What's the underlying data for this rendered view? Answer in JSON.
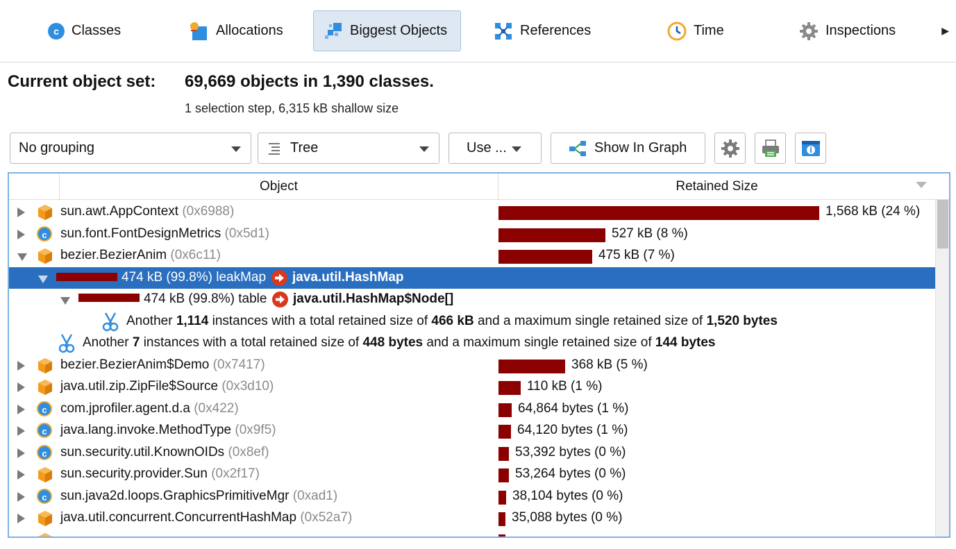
{
  "tabs": [
    {
      "label": "Classes",
      "icon": "class-icon"
    },
    {
      "label": "Allocations",
      "icon": "allocations-icon"
    },
    {
      "label": "Biggest Objects",
      "icon": "biggest-objects-icon",
      "active": true
    },
    {
      "label": "References",
      "icon": "references-icon"
    },
    {
      "label": "Time",
      "icon": "clock-icon"
    },
    {
      "label": "Inspections",
      "icon": "gear-icon"
    }
  ],
  "header": {
    "label": "Current object set:",
    "value": "69,669 objects in 1,390 classes.",
    "subtitle": "1 selection step, 6,315 kB shallow size"
  },
  "toolbar": {
    "grouping": "No grouping",
    "view": "Tree",
    "use": "Use ...",
    "show_in_graph": "Show In Graph"
  },
  "table": {
    "col_object": "Object",
    "col_retained": "Retained Size",
    "rows": [
      {
        "name": "sun.awt.AppContext",
        "addr": "(0x6988)",
        "size": "1,568 kB (24 %)",
        "pct": 24,
        "icon": "cube"
      },
      {
        "name": "sun.font.FontDesignMetrics",
        "addr": "(0x5d1)",
        "size": "527 kB (8 %)",
        "pct": 8,
        "icon": "class"
      },
      {
        "name": "bezier.BezierAnim",
        "addr": "(0x6c11)",
        "size": "475 kB (7 %)",
        "pct": 7,
        "icon": "cube"
      },
      {
        "name": "bezier.BezierAnim$Demo",
        "addr": "(0x7417)",
        "size": "368 kB (5 %)",
        "pct": 5,
        "icon": "cube"
      },
      {
        "name": "java.util.zip.ZipFile$Source",
        "addr": "(0x3d10)",
        "size": "110 kB (1 %)",
        "pct": 1.65,
        "icon": "cube"
      },
      {
        "name": "com.jprofiler.agent.d.a",
        "addr": "(0x422)",
        "size": "64,864 bytes (1 %)",
        "pct": 0.97,
        "icon": "class"
      },
      {
        "name": "java.lang.invoke.MethodType",
        "addr": "(0x9f5)",
        "size": "64,120 bytes (1 %)",
        "pct": 0.96,
        "icon": "class"
      },
      {
        "name": "sun.security.util.KnownOIDs",
        "addr": "(0x8ef)",
        "size": "53,392 bytes (0 %)",
        "pct": 0.8,
        "icon": "class"
      },
      {
        "name": "sun.security.provider.Sun",
        "addr": "(0x2f17)",
        "size": "53,264 bytes (0 %)",
        "pct": 0.8,
        "icon": "cube"
      },
      {
        "name": "sun.java2d.loops.GraphicsPrimitiveMgr",
        "addr": "(0xad1)",
        "size": "38,104 bytes (0 %)",
        "pct": 0.57,
        "icon": "class"
      },
      {
        "name": "java.util.concurrent.ConcurrentHashMap",
        "addr": "(0x52a7)",
        "size": "35,088 bytes (0 %)",
        "pct": 0.53,
        "icon": "cube"
      }
    ],
    "leak": {
      "size": "474 kB (99.8%)",
      "field": "leakMap",
      "type": "java.util.HashMap"
    },
    "node": {
      "size": "474 kB (99.8%)",
      "field": "table",
      "type": "java.util.HashMap$Node[]"
    },
    "another1": {
      "pre": "Another",
      "count": "1,114",
      "mid": "instances with a total retained size of",
      "total": "466 kB",
      "mid2": "and a maximum single retained size of",
      "max": "1,520 bytes"
    },
    "another2": {
      "pre": "Another",
      "count": "7",
      "mid": "instances with a total retained size of",
      "total": "448 bytes",
      "mid2": "and a maximum single retained size of",
      "max": "144 bytes"
    }
  },
  "colors": {
    "bar": "#8b0000",
    "selection": "#2a6fbf",
    "accent": "#2f8ee0"
  }
}
